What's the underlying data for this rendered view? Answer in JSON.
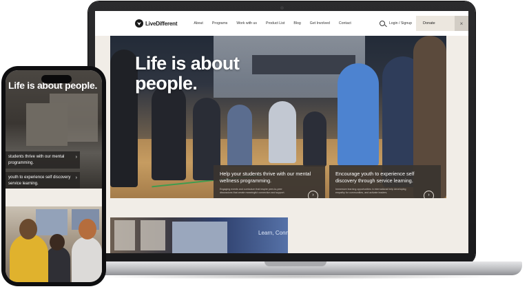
{
  "site": {
    "logo_text": "LiveDifferent",
    "nav_items": [
      "About",
      "Programs",
      "Work with us",
      "Product List",
      "Blog",
      "Get Involved",
      "Contact"
    ],
    "login_label": "Login / Signup",
    "donate_label": "Donate"
  },
  "hero": {
    "title": "Life is about people.",
    "cards": [
      {
        "heading": "Help your students thrive with our mental wellness programming.",
        "body": "Engaging events and curriculum that inspire peer-to-peer discussions that create meaningful connection and support."
      },
      {
        "heading": "Encourage youth to experience self discovery through service learning.",
        "body": "Immersive learning opportunities in international help developing empathy for communities, and activate leaders."
      }
    ]
  },
  "strip": {
    "overlay_text": "Learn, Conn"
  },
  "phone": {
    "title": "Life is about people.",
    "cards": [
      "students thrive with our mental programming.",
      "youth to experience self discovery service learning."
    ]
  },
  "colors": {
    "page_bg": "#f1ede7",
    "card_bg": "#3a3430",
    "donate_bg": "#ece7df"
  }
}
